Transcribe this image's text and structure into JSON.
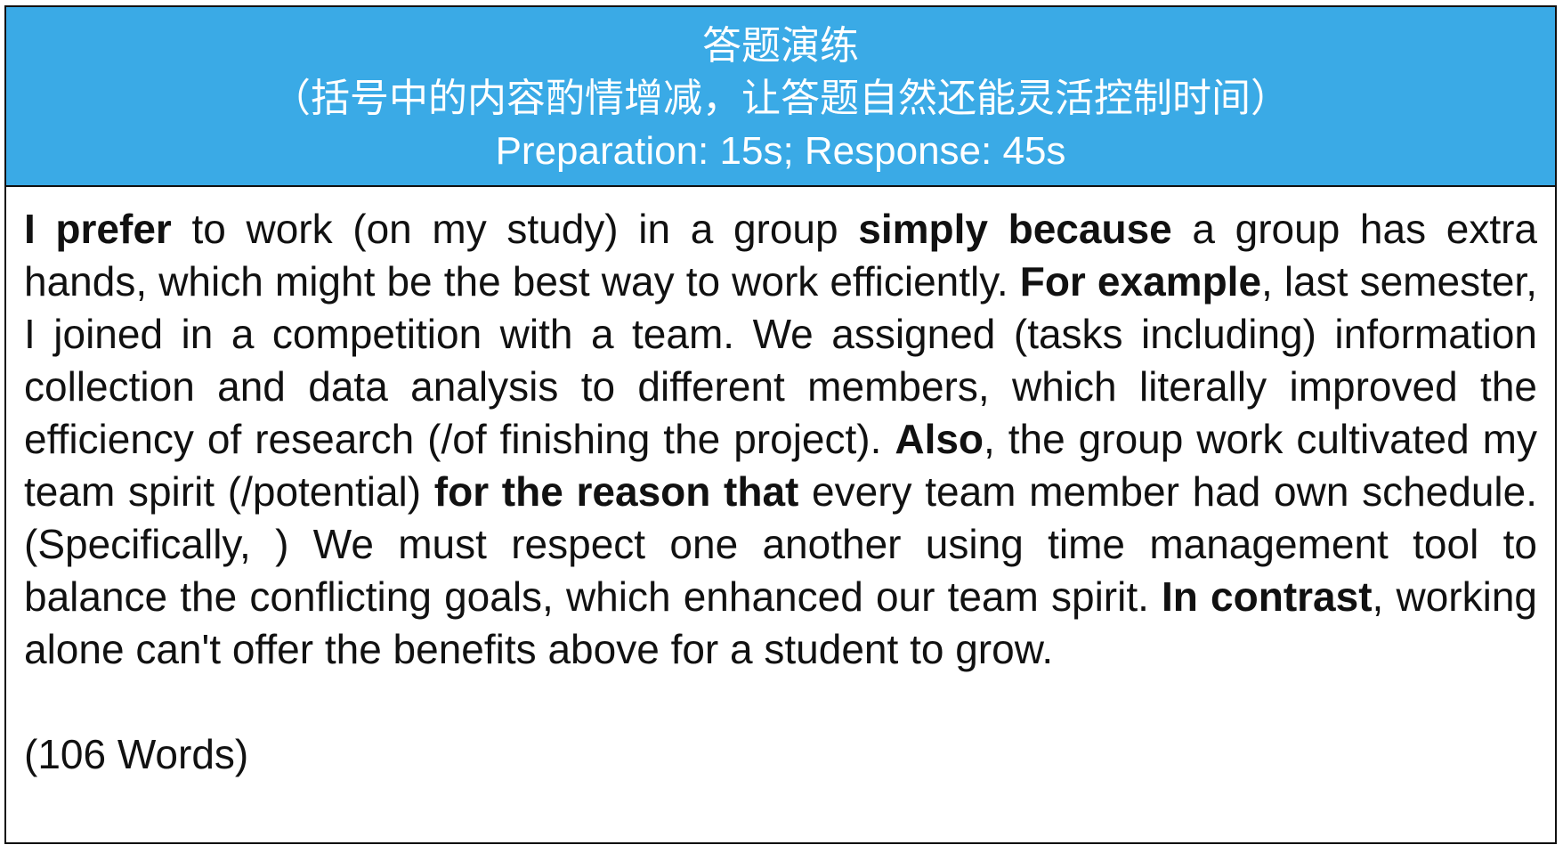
{
  "header": {
    "title": "答题演练",
    "note": "（括号中的内容酌情增减，让答题自然还能灵活控制时间）",
    "timing": "Preparation: 15s; Response: 45s"
  },
  "answer": {
    "segments": [
      {
        "text": "I prefer",
        "bold": true
      },
      {
        "text": " to work (on my study) in a group ",
        "bold": false
      },
      {
        "text": "simply because",
        "bold": true
      },
      {
        "text": " a group has extra hands, which might be the best way to work efficiently. ",
        "bold": false
      },
      {
        "text": "For example",
        "bold": true
      },
      {
        "text": ", last semester, I joined in a competition with a team. We assigned (tasks including) information collection and data analysis to different members, which literally improved the efficiency of research (/of finishing the project). ",
        "bold": false
      },
      {
        "text": "Also",
        "bold": true
      },
      {
        "text": ", the group work cultivated my team spirit (/potential) ",
        "bold": false
      },
      {
        "text": "for the reason that",
        "bold": true
      },
      {
        "text": " every team member had own schedule. (Specifically, ) We must respect one another using time management tool to balance the conflicting goals, which enhanced our team spirit. ",
        "bold": false
      },
      {
        "text": "In contrast",
        "bold": true
      },
      {
        "text": ", working alone can't offer the benefits above for a student to grow.",
        "bold": false
      }
    ],
    "word_count": "(106 Words)"
  },
  "colors": {
    "header_bg": "#3aaae6",
    "header_text": "#ffffff",
    "border": "#111111",
    "body_text": "#111111"
  }
}
